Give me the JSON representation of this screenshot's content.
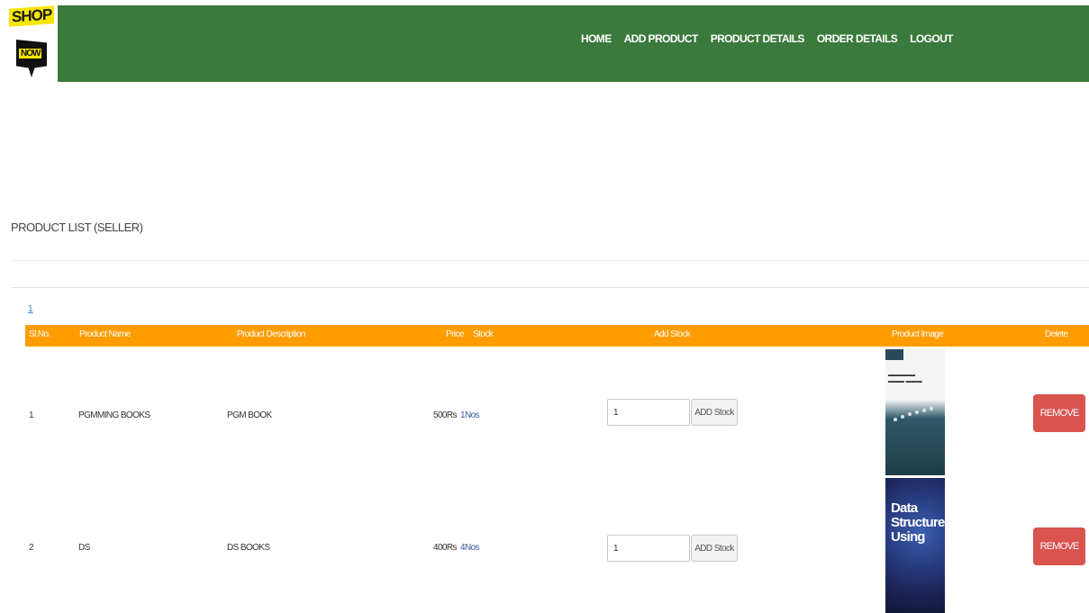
{
  "logo": {
    "line1": "SHOP",
    "line2": "NOW"
  },
  "nav": [
    "HOME",
    "ADD PRODUCT",
    "PRODUCT DETAILS",
    "ORDER DETAILS",
    "LOGOUT"
  ],
  "section_title": "PRODUCT LIST (SELLER)",
  "small_link": "1",
  "table": {
    "headers": [
      "Sl.No.",
      "Product Name",
      "Product Description",
      "Price",
      "Stock",
      "Add Stock",
      "Product Image",
      "Delete"
    ],
    "rows": [
      {
        "sl": "1",
        "name": "PGMMING BOOKS",
        "description": "PGM BOOK",
        "price": "500Rs",
        "stock": "1Nos",
        "qty": "1",
        "add_label": "ADD Stock",
        "remove_label": "REMOVE",
        "image_icon": "programming-book-cover-image"
      },
      {
        "sl": "2",
        "name": "DS",
        "description": "DS BOOKS",
        "price": "400Rs",
        "stock": "4Nos",
        "qty": "1",
        "add_label": "ADD Stock",
        "remove_label": "REMOVE",
        "image_icon": "data-structure-book-cover-image"
      }
    ]
  },
  "book2_title": "Data Structure Using",
  "colors": {
    "navbar": "#3a7a3c",
    "table_header": "#ff9c00",
    "remove_button": "#d9534f",
    "link": "#3a78c3"
  }
}
